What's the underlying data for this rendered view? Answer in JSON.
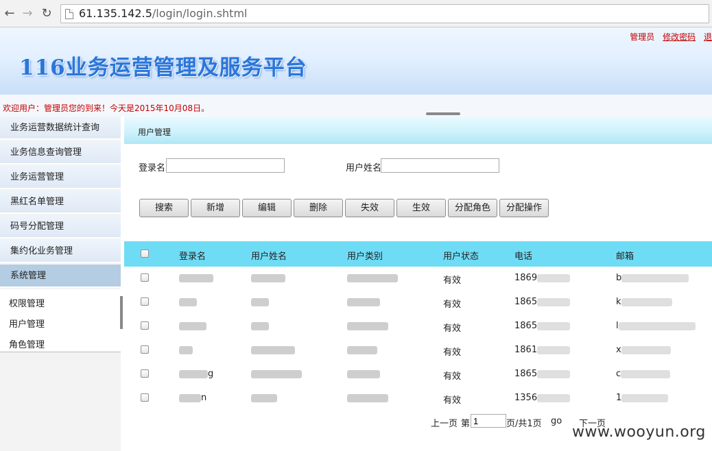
{
  "browser": {
    "url_host": "61.135.142.5",
    "url_path": "/login/login.shtml"
  },
  "header": {
    "site_title": "116业务运营管理及服务平台",
    "user_label": "管理员",
    "change_password": "修改密码",
    "logout_partial": "退"
  },
  "welcome": {
    "text": "欢迎用户：管理员您的到来！今天是2015年10月08日。"
  },
  "sidebar": {
    "items": [
      {
        "label": "业务运营数据统计查询"
      },
      {
        "label": "业务信息查询管理"
      },
      {
        "label": "业务运营管理"
      },
      {
        "label": "黑红名单管理"
      },
      {
        "label": "码号分配管理"
      },
      {
        "label": "集约化业务管理"
      },
      {
        "label": "系统管理"
      }
    ],
    "sub_items": [
      {
        "label": "权限管理"
      },
      {
        "label": "用户管理"
      },
      {
        "label": "角色管理"
      }
    ]
  },
  "main": {
    "title": "用户管理",
    "search": {
      "login_label": "登录名",
      "name_label": "用户姓名",
      "login_value": "",
      "name_value": ""
    },
    "buttons": [
      "搜索",
      "新增",
      "编辑",
      "删除",
      "失效",
      "生效",
      "分配角色",
      "分配操作"
    ],
    "table": {
      "columns": [
        "登录名",
        "用户姓名",
        "用户类别",
        "用户状态",
        "电话",
        "邮箱"
      ],
      "rows": [
        {
          "login_visible": "",
          "status": "有效",
          "phone_prefix": "1869",
          "email_prefix": "b"
        },
        {
          "login_visible": "",
          "status": "有效",
          "phone_prefix": "1865",
          "email_prefix": "k"
        },
        {
          "login_visible": "",
          "status": "有效",
          "phone_prefix": "1865",
          "email_prefix": "l"
        },
        {
          "login_visible": "",
          "status": "有效",
          "phone_prefix": "1861",
          "email_prefix": "x"
        },
        {
          "login_visible": "g",
          "status": "有效",
          "phone_prefix": "1865",
          "email_prefix": "c"
        },
        {
          "login_visible": "n",
          "status": "有效",
          "phone_prefix": "1356",
          "email_prefix": "1"
        }
      ]
    },
    "pager": {
      "prev": "上一页",
      "page_prefix": "第",
      "page_value": "1",
      "page_suffix": "页/共1页",
      "go": "go",
      "next": "下一页"
    }
  },
  "watermark": "www.wooyun.org"
}
